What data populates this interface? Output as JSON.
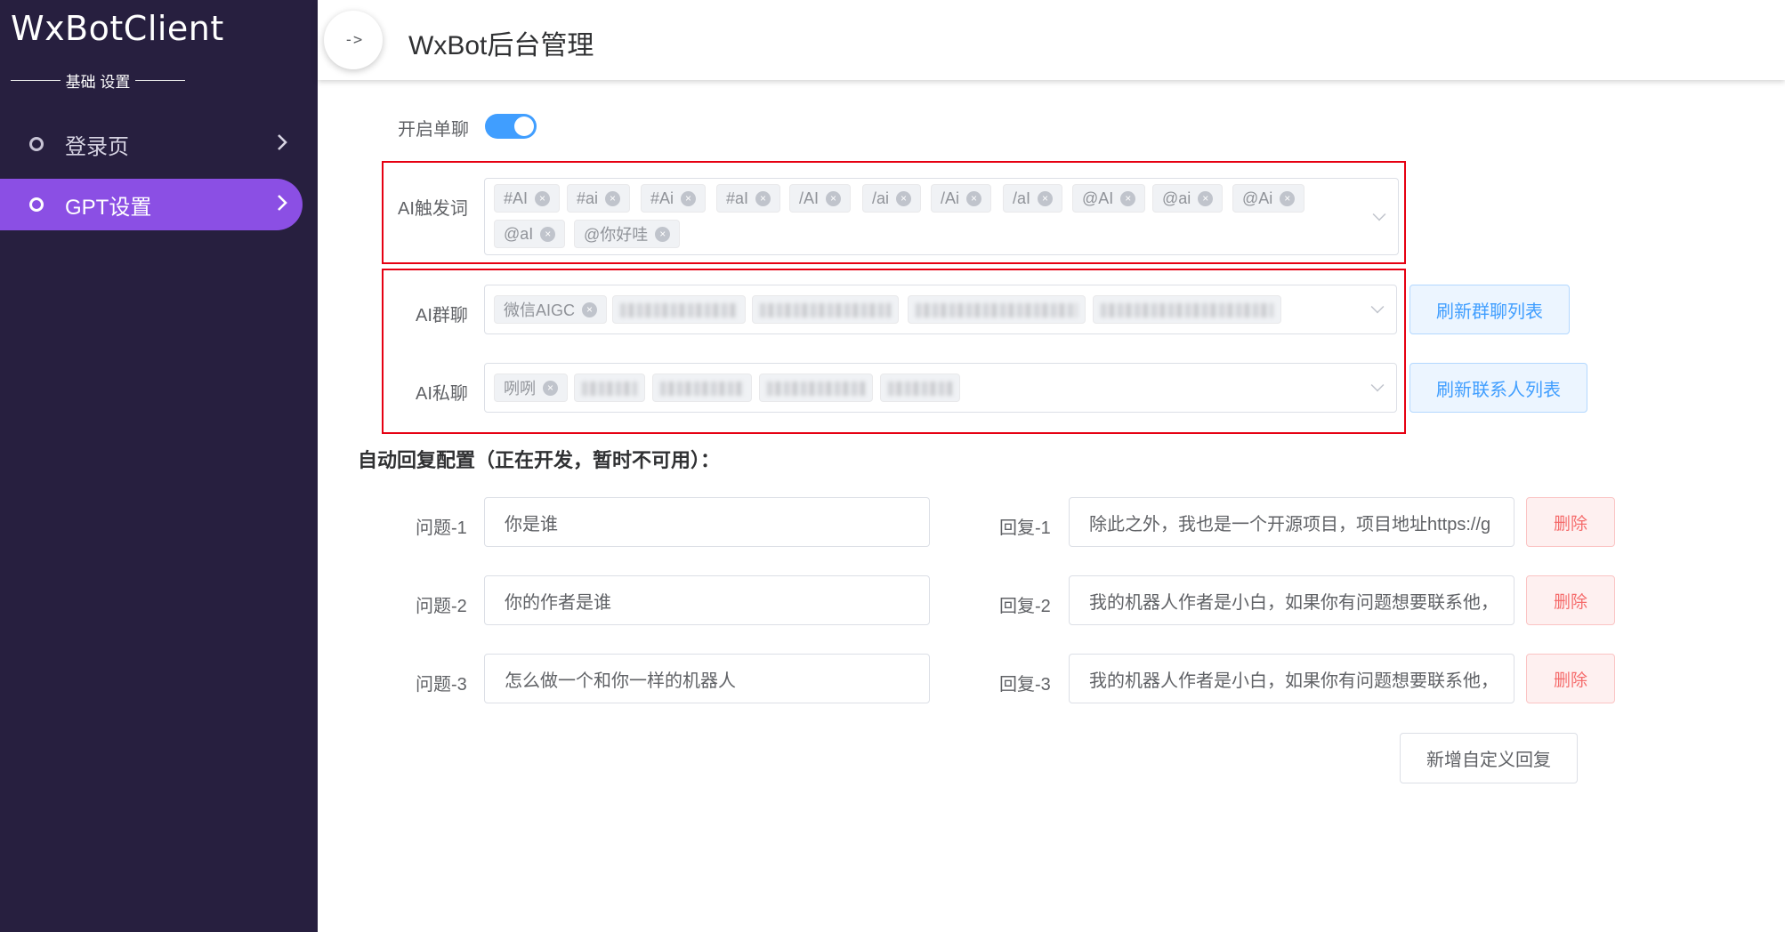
{
  "sidebar": {
    "logo": "WxBotClient",
    "section": "基础 设置",
    "items": [
      {
        "label": "登录页",
        "active": false
      },
      {
        "label": "GPT设置",
        "active": true
      }
    ]
  },
  "header": {
    "toggle_label": "->",
    "title": "WxBot后台管理"
  },
  "form": {
    "single_chat": {
      "label": "开启单聊",
      "enabled": true
    },
    "ai_trigger": {
      "label": "AI触发词",
      "tags": [
        "#AI",
        "#ai",
        "#Ai",
        "#aI",
        "/AI",
        "/ai",
        "/Ai",
        "/aI",
        "@AI",
        "@ai",
        "@Ai",
        "@aI",
        "@你好哇"
      ]
    },
    "ai_group": {
      "label": "AI群聊",
      "tags": [
        "微信AIGC"
      ],
      "button": "刷新群聊列表"
    },
    "ai_private": {
      "label": "AI私聊",
      "tags": [
        "咧咧"
      ],
      "button": "刷新联系人列表"
    }
  },
  "auto_reply": {
    "title": "自动回复配置（正在开发，暂时不可用）：",
    "rows": [
      {
        "q_label": "问题-1",
        "question": "你是谁",
        "r_label": "回复-1",
        "reply": "除此之外，我也是一个开源项目，项目地址https://g",
        "delete": "删除"
      },
      {
        "q_label": "问题-2",
        "question": "你的作者是谁",
        "r_label": "回复-2",
        "reply": "我的机器人作者是小白，如果你有问题想要联系他，",
        "delete": "删除"
      },
      {
        "q_label": "问题-3",
        "question": "怎么做一个和你一样的机器人",
        "r_label": "回复-3",
        "reply": "我的机器人作者是小白，如果你有问题想要联系他，",
        "delete": "删除"
      }
    ],
    "add_button": "新增自定义回复"
  },
  "colors": {
    "sidebar_bg": "#271f3f",
    "active_menu": "#8b4fe4",
    "primary": "#409eff",
    "danger": "#f56c6c",
    "highlight_box": "#e60012"
  }
}
